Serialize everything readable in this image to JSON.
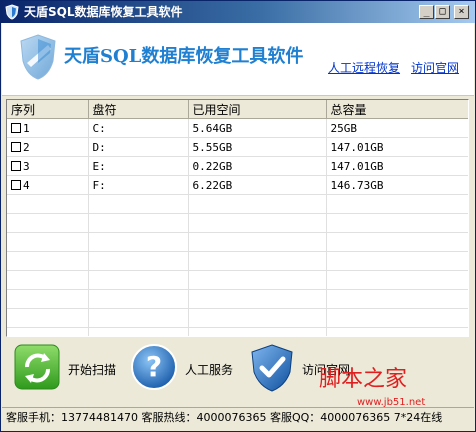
{
  "window": {
    "title": "天盾SQL数据库恢复工具软件",
    "controls": {
      "minimize": "_",
      "maximize": "□",
      "close": "×"
    }
  },
  "header": {
    "heading": "天盾SQL数据库恢复工具软件",
    "links": {
      "remote_recovery": "人工远程恢复",
      "official_site": "访问官网"
    }
  },
  "table": {
    "columns": [
      "序列",
      "盘符",
      "已用空间",
      "总容量"
    ],
    "rows": [
      {
        "index": "1",
        "drive": "C:",
        "used": "5.64GB",
        "total": "25GB"
      },
      {
        "index": "2",
        "drive": "D:",
        "used": "5.55GB",
        "total": "147.01GB"
      },
      {
        "index": "3",
        "drive": "E:",
        "used": "0.22GB",
        "total": "147.01GB"
      },
      {
        "index": "4",
        "drive": "F:",
        "used": "6.22GB",
        "total": "146.73GB"
      }
    ]
  },
  "actions": {
    "scan": "开始扫描",
    "service": "人工服务",
    "visit": "访问官网"
  },
  "watermark": {
    "text": "脚本之家",
    "url": "www.jb51.net"
  },
  "status": {
    "text": "客服手机：13774481470 客服热线：4000076365 客服QQ：4000076365 7*24在线"
  },
  "colors": {
    "title_bar": "#0a246a",
    "heading": "#1f7fd1",
    "link": "#0033cc",
    "window_bg": "#ece9d8",
    "scan_green": "#3fae29",
    "service_blue": "#1e73c8"
  }
}
